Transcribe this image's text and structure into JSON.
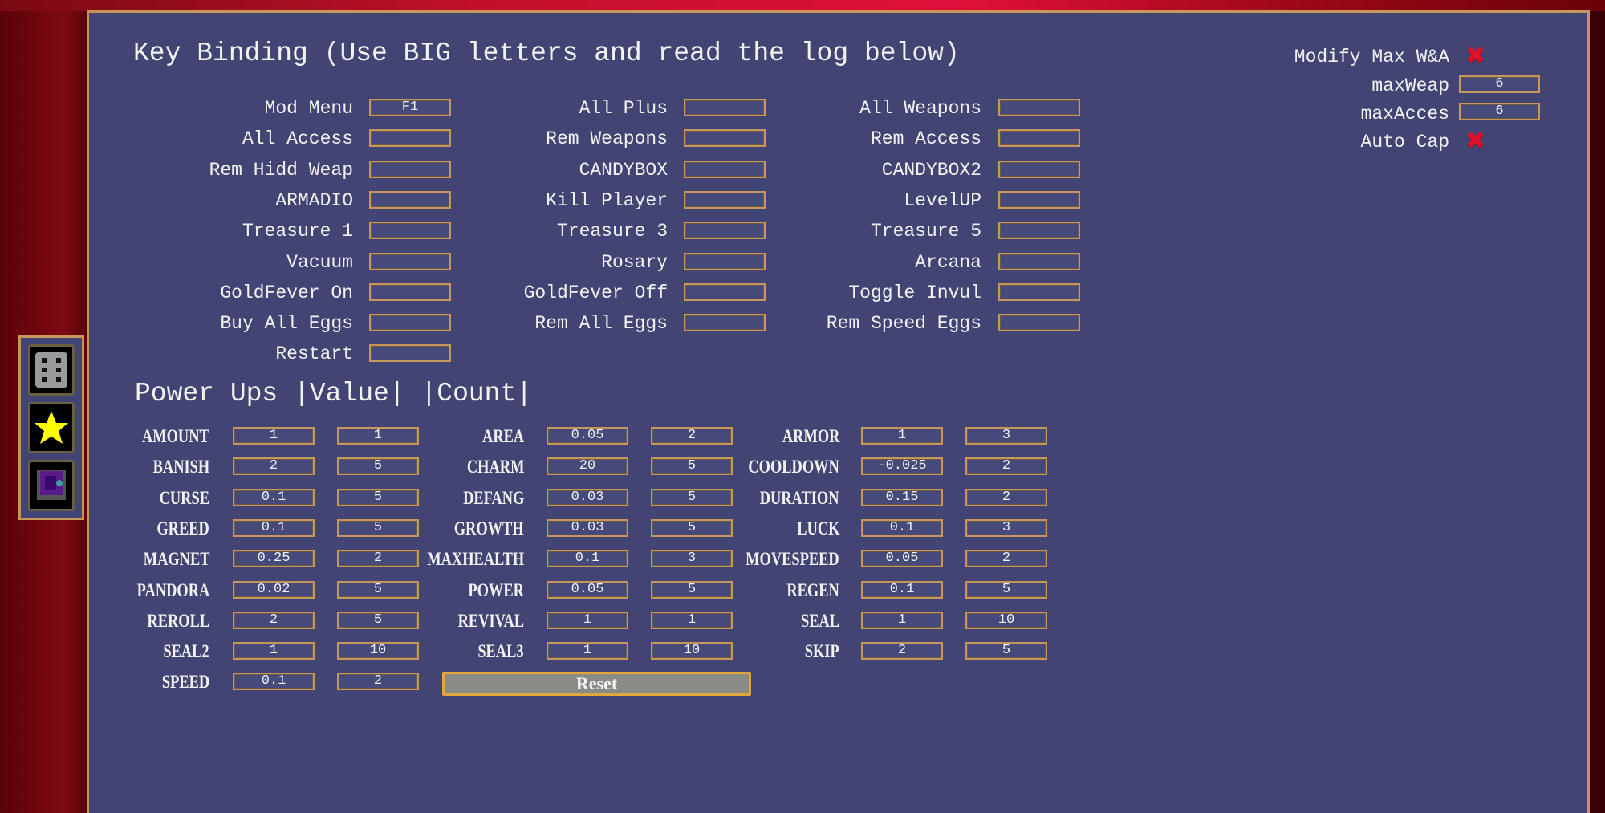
{
  "title": "Key Binding (Use BIG letters and read the log below)",
  "keybindings": [
    [
      {
        "label": "Mod Menu",
        "key": "F1"
      },
      {
        "label": "All Plus",
        "key": ""
      },
      {
        "label": "All Weapons",
        "key": ""
      }
    ],
    [
      {
        "label": "All Access",
        "key": ""
      },
      {
        "label": "Rem Weapons",
        "key": ""
      },
      {
        "label": "Rem Access",
        "key": ""
      }
    ],
    [
      {
        "label": "Rem Hidd Weap",
        "key": ""
      },
      {
        "label": "CANDYBOX",
        "key": ""
      },
      {
        "label": "CANDYBOX2",
        "key": ""
      }
    ],
    [
      {
        "label": "ARMADIO",
        "key": ""
      },
      {
        "label": "Kill Player",
        "key": ""
      },
      {
        "label": "LevelUP",
        "key": ""
      }
    ],
    [
      {
        "label": "Treasure 1",
        "key": ""
      },
      {
        "label": "Treasure 3",
        "key": ""
      },
      {
        "label": "Treasure 5",
        "key": ""
      }
    ],
    [
      {
        "label": "Vacuum",
        "key": ""
      },
      {
        "label": "Rosary",
        "key": ""
      },
      {
        "label": "Arcana",
        "key": ""
      }
    ],
    [
      {
        "label": "GoldFever On",
        "key": ""
      },
      {
        "label": "GoldFever Off",
        "key": ""
      },
      {
        "label": "Toggle Invul",
        "key": ""
      }
    ],
    [
      {
        "label": "Buy All Eggs",
        "key": ""
      },
      {
        "label": "Rem All Eggs",
        "key": ""
      },
      {
        "label": "Rem Speed Eggs",
        "key": ""
      }
    ],
    [
      {
        "label": "Restart",
        "key": ""
      }
    ]
  ],
  "max_settings": {
    "modify_label": "Modify Max W&A",
    "modify_enabled": false,
    "max_weap_label": "maxWeap",
    "max_weap_value": "6",
    "max_acces_label": "maxAcces",
    "max_acces_value": "6",
    "auto_cap_label": "Auto Cap",
    "auto_cap_enabled": false,
    "x_glyph": "✖"
  },
  "powerups_header": "Power Ups |Value| |Count|",
  "powerups": [
    [
      {
        "name": "AMOUNT",
        "value": "1",
        "count": "1"
      },
      {
        "name": "AREA",
        "value": "0.05",
        "count": "2"
      },
      {
        "name": "ARMOR",
        "value": "1",
        "count": "3"
      }
    ],
    [
      {
        "name": "BANISH",
        "value": "2",
        "count": "5"
      },
      {
        "name": "CHARM",
        "value": "20",
        "count": "5"
      },
      {
        "name": "COOLDOWN",
        "value": "-0.025",
        "count": "2"
      }
    ],
    [
      {
        "name": "CURSE",
        "value": "0.1",
        "count": "5"
      },
      {
        "name": "DEFANG",
        "value": "0.03",
        "count": "5"
      },
      {
        "name": "DURATION",
        "value": "0.15",
        "count": "2"
      }
    ],
    [
      {
        "name": "GREED",
        "value": "0.1",
        "count": "5"
      },
      {
        "name": "GROWTH",
        "value": "0.03",
        "count": "5"
      },
      {
        "name": "LUCK",
        "value": "0.1",
        "count": "3"
      }
    ],
    [
      {
        "name": "MAGNET",
        "value": "0.25",
        "count": "2"
      },
      {
        "name": "MAXHEALTH",
        "value": "0.1",
        "count": "3"
      },
      {
        "name": "MOVESPEED",
        "value": "0.05",
        "count": "2"
      }
    ],
    [
      {
        "name": "PANDORA",
        "value": "0.02",
        "count": "5"
      },
      {
        "name": "POWER",
        "value": "0.05",
        "count": "5"
      },
      {
        "name": "REGEN",
        "value": "0.1",
        "count": "5"
      }
    ],
    [
      {
        "name": "REROLL",
        "value": "2",
        "count": "5"
      },
      {
        "name": "REVIVAL",
        "value": "1",
        "count": "1"
      },
      {
        "name": "SEAL",
        "value": "1",
        "count": "10"
      }
    ],
    [
      {
        "name": "SEAL2",
        "value": "1",
        "count": "10"
      },
      {
        "name": "SEAL3",
        "value": "1",
        "count": "10"
      },
      {
        "name": "SKIP",
        "value": "2",
        "count": "5"
      }
    ],
    [
      {
        "name": "SPEED",
        "value": "0.1",
        "count": "2"
      }
    ]
  ],
  "reset_label": "Reset",
  "sidebar": [
    {
      "icon": "dice-icon"
    },
    {
      "icon": "star-icon",
      "color": "#ffff00"
    },
    {
      "icon": "spellbook-icon",
      "color": "#5a1a8a"
    }
  ],
  "colors": {
    "panel": "#424573",
    "border": "#c8955a",
    "x_mark": "#e0102a"
  }
}
